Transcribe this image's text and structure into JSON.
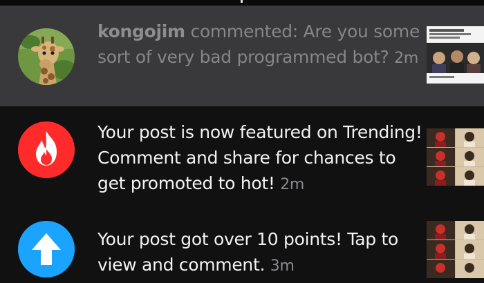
{
  "notifications": [
    {
      "user": "kongojim",
      "message": " commented: Are you some sort of very bad programmed bot?",
      "time": "2m",
      "icon": "giraffe-avatar",
      "thumbnail": "meme-screenshot-thumbnail",
      "dimmed": true
    },
    {
      "message": "Your post is now featured on Trending! Comment and share for chances to get promoted to hot!",
      "time": "2m",
      "icon": "flame-icon",
      "icon_color": "#ff2b2b",
      "thumbnail": "anime-grid-thumbnail"
    },
    {
      "message": "Your post got over 10 points! Tap to view and comment.",
      "time": "3m",
      "icon": "arrow-up-icon",
      "icon_color": "#1aa3ff",
      "thumbnail": "anime-grid-thumbnail"
    }
  ]
}
